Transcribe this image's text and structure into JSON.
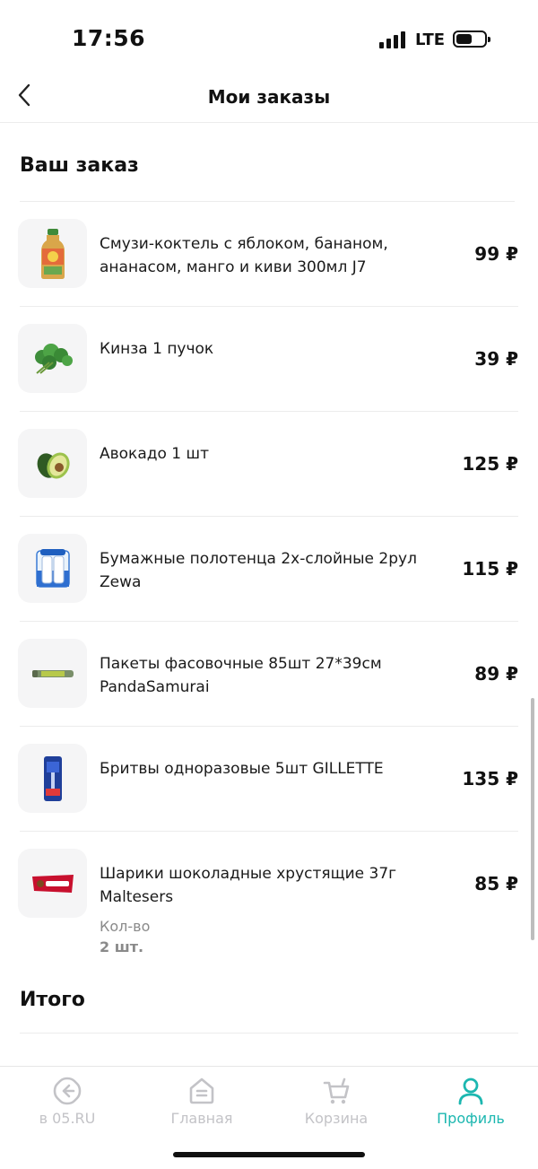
{
  "status": {
    "time": "17:56",
    "network": "LTE"
  },
  "header": {
    "title": "Мои заказы"
  },
  "order": {
    "section_title": "Ваш заказ",
    "items": [
      {
        "name": "Смузи-коктель с яблоком, бананом, ананасом, манго и киви 300мл J7",
        "price": "99 ₽",
        "image": "smoothie-bottle"
      },
      {
        "name": "Кинза 1 пучок",
        "price": "39 ₽",
        "image": "cilantro-bunch"
      },
      {
        "name": "Авокадо 1 шт",
        "price": "125 ₽",
        "image": "avocado"
      },
      {
        "name": "Бумажные полотенца 2х-слойные 2рул Zewa",
        "price": "115 ₽",
        "image": "paper-towels"
      },
      {
        "name": "Пакеты фасовочные 85шт 27*39см PandaSamurai",
        "price": "89 ₽",
        "image": "bag-roll"
      },
      {
        "name": "Бритвы одноразовые 5шт GILLETTE",
        "price": "135 ₽",
        "image": "razors-pack"
      },
      {
        "name": "Шарики шоколадные хрустящие 37г Maltesers",
        "price": "85 ₽",
        "image": "maltesers-pack",
        "qty_label": "Кол-во",
        "qty_value": "2 шт."
      }
    ],
    "total_title": "Итого"
  },
  "tabbar": {
    "tabs": [
      {
        "label": "в 05.RU",
        "icon": "back-circle-icon",
        "active": false
      },
      {
        "label": "Главная",
        "icon": "home-icon",
        "active": false
      },
      {
        "label": "Корзина",
        "icon": "cart-icon",
        "active": false
      },
      {
        "label": "Профиль",
        "icon": "profile-icon",
        "active": true
      }
    ]
  },
  "colors": {
    "accent": "#1cb7b0",
    "inactive": "#c3c3c7",
    "thumb_bg": "#f5f5f6",
    "divider": "#ececec"
  }
}
